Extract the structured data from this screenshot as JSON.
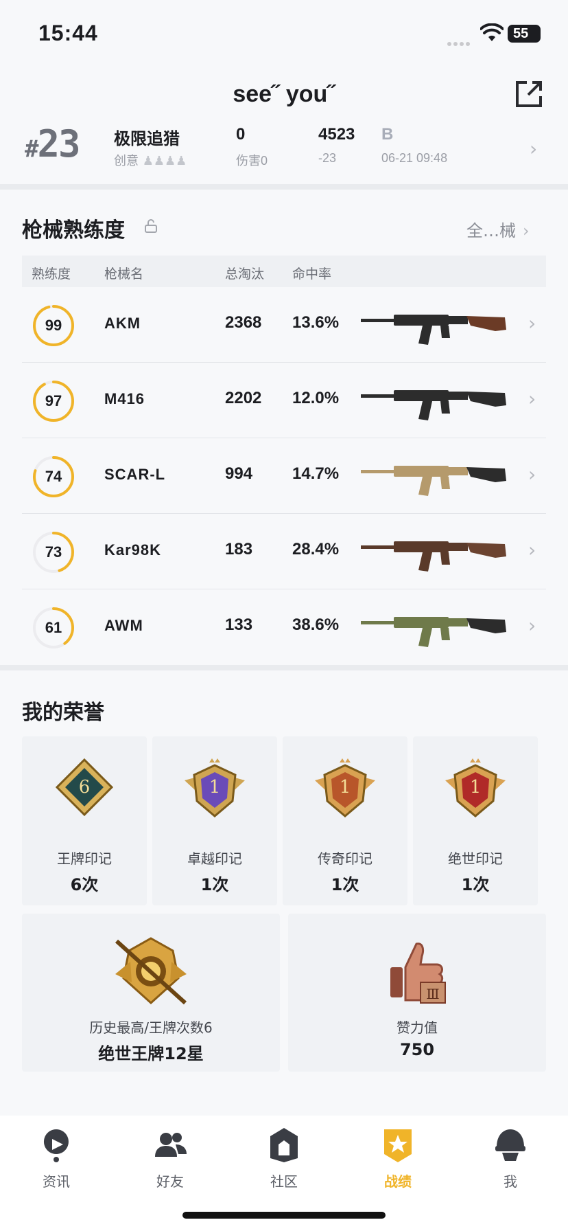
{
  "status_bar": {
    "time": "15:44",
    "battery": "55"
  },
  "header": {
    "title": "see˝  you˝",
    "share_icon": "share-export-icon"
  },
  "summary": {
    "rank": "23",
    "mode": "极限追猎",
    "mode_sub": "创意",
    "damage": "0",
    "damage_label": "伤害0",
    "score": "4523",
    "score_change": "-23",
    "grade": "B",
    "datetime": "06-21 09:48"
  },
  "weapons": {
    "title": "枪械熟练度",
    "all_link": "全…械",
    "headers": {
      "mastery": "熟练度",
      "name": "枪械名",
      "kills": "总淘汰",
      "accuracy": "命中率"
    },
    "rows": [
      {
        "mastery": "99",
        "progress": 0.96,
        "name": "AKM",
        "kills": "2368",
        "accuracy": "13.6%"
      },
      {
        "mastery": "97",
        "progress": 0.92,
        "name": "M416",
        "kills": "2202",
        "accuracy": "12.0%"
      },
      {
        "mastery": "74",
        "progress": 0.8,
        "name": "SCAR-L",
        "kills": "994",
        "accuracy": "14.7%"
      },
      {
        "mastery": "73",
        "progress": 0.45,
        "name": "Kar98K",
        "kills": "183",
        "accuracy": "28.4%"
      },
      {
        "mastery": "61",
        "progress": 0.4,
        "name": "AWM",
        "kills": "133",
        "accuracy": "38.6%"
      }
    ]
  },
  "honors": {
    "title": "我的荣誉",
    "cards": [
      {
        "label": "王牌印记",
        "value": "6次",
        "badge_text": "6"
      },
      {
        "label": "卓越印记",
        "value": "1次",
        "badge_text": "1"
      },
      {
        "label": "传奇印记",
        "value": "1次",
        "badge_text": "1"
      },
      {
        "label": "绝世印记",
        "value": "1次",
        "badge_text": "1"
      }
    ],
    "history": {
      "label": "历史最高/王牌次数6",
      "value": "绝世王牌12星"
    },
    "likes": {
      "label": "赞力值",
      "value": "750"
    }
  },
  "tabbar": [
    {
      "label": "资讯",
      "icon": "news-icon"
    },
    {
      "label": "好友",
      "icon": "friends-icon"
    },
    {
      "label": "社区",
      "icon": "community-icon"
    },
    {
      "label": "战绩",
      "icon": "record-icon",
      "active": true
    },
    {
      "label": "我",
      "icon": "profile-helmet-icon"
    }
  ],
  "colors": {
    "accent": "#f0b429",
    "ring_track": "#ececef"
  }
}
